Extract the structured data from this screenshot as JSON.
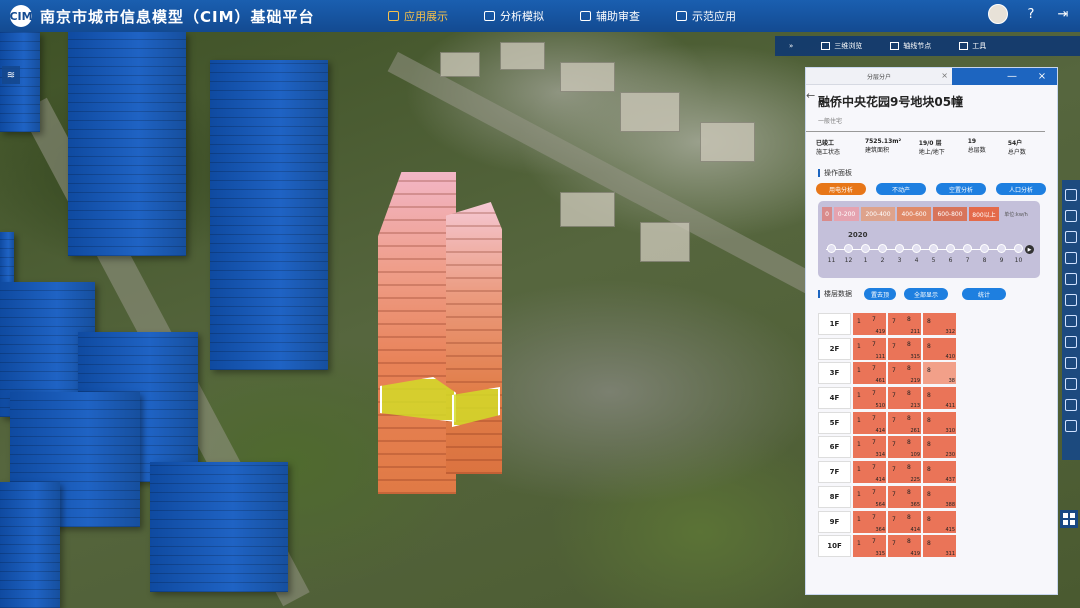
{
  "app": {
    "title": "南京市城市信息模型（CIM）基础平台",
    "logo_text": "CIM"
  },
  "nav": [
    {
      "label": "应用展示",
      "active": true
    },
    {
      "label": "分析模拟",
      "active": false
    },
    {
      "label": "辅助审查",
      "active": false
    },
    {
      "label": "示范应用",
      "active": false
    }
  ],
  "topbar_icons": [
    "user-avatar",
    "help-icon",
    "logout-icon"
  ],
  "subbar": [
    {
      "label": "三维浏览"
    },
    {
      "label": "轴线节点"
    },
    {
      "label": "工具"
    }
  ],
  "panel": {
    "tab_label": "分层分户",
    "building_name": "融侨中央花园9号地块05幢",
    "building_type": "一般住宅",
    "stats": [
      {
        "value": "已竣工",
        "label": "施工状态"
      },
      {
        "value": "7525.13m²",
        "label": "建筑面积"
      },
      {
        "value": "19/0 层",
        "label": "地上/地下"
      },
      {
        "value": "19",
        "label": "总层数"
      },
      {
        "value": "54户",
        "label": "总户数"
      }
    ],
    "ops_title": "操作面板",
    "ops_buttons": [
      "用电分析",
      "不动产",
      "空置分析",
      "人口分析"
    ],
    "legend": [
      "0",
      "0-200",
      "200-400",
      "400-600",
      "600-800",
      "800以上"
    ],
    "legend_unit": "单位:kw/h",
    "year": "2020",
    "months": [
      "11",
      "12",
      "1",
      "2",
      "3",
      "4",
      "5",
      "6",
      "7",
      "8",
      "9",
      "10"
    ],
    "floor_title": "楼层数据",
    "floor_buttons": [
      "置去顶",
      "全部显示",
      "统计"
    ],
    "floors": [
      {
        "label": "1F",
        "units": [
          {
            "n": "1",
            "h": "7",
            "p": "419"
          },
          {
            "n": "7",
            "h": "8",
            "p": "211"
          },
          {
            "n": "8",
            "h": "",
            "p": "312"
          }
        ]
      },
      {
        "label": "2F",
        "units": [
          {
            "n": "1",
            "h": "7",
            "p": "111"
          },
          {
            "n": "7",
            "h": "8",
            "p": "315"
          },
          {
            "n": "8",
            "h": "",
            "p": "410"
          }
        ]
      },
      {
        "label": "3F",
        "units": [
          {
            "n": "1",
            "h": "7",
            "p": "461"
          },
          {
            "n": "7",
            "h": "8",
            "p": "219"
          },
          {
            "n": "8",
            "h": "",
            "p": "38"
          }
        ]
      },
      {
        "label": "4F",
        "units": [
          {
            "n": "1",
            "h": "7",
            "p": "510"
          },
          {
            "n": "7",
            "h": "8",
            "p": "213"
          },
          {
            "n": "8",
            "h": "",
            "p": "411"
          }
        ]
      },
      {
        "label": "5F",
        "units": [
          {
            "n": "1",
            "h": "7",
            "p": "414"
          },
          {
            "n": "7",
            "h": "8",
            "p": "261"
          },
          {
            "n": "8",
            "h": "",
            "p": "310"
          }
        ]
      },
      {
        "label": "6F",
        "units": [
          {
            "n": "1",
            "h": "7",
            "p": "314"
          },
          {
            "n": "7",
            "h": "8",
            "p": "109"
          },
          {
            "n": "8",
            "h": "",
            "p": "230"
          }
        ]
      },
      {
        "label": "7F",
        "units": [
          {
            "n": "1",
            "h": "7",
            "p": "414"
          },
          {
            "n": "7",
            "h": "8",
            "p": "225"
          },
          {
            "n": "8",
            "h": "",
            "p": "437"
          }
        ]
      },
      {
        "label": "8F",
        "units": [
          {
            "n": "1",
            "h": "7",
            "p": "564"
          },
          {
            "n": "7",
            "h": "8",
            "p": "365"
          },
          {
            "n": "8",
            "h": "",
            "p": "388"
          }
        ]
      },
      {
        "label": "9F",
        "units": [
          {
            "n": "1",
            "h": "7",
            "p": "364"
          },
          {
            "n": "7",
            "h": "8",
            "p": "414"
          },
          {
            "n": "8",
            "h": "",
            "p": "415"
          }
        ]
      },
      {
        "label": "10F",
        "units": [
          {
            "n": "1",
            "h": "7",
            "p": "315"
          },
          {
            "n": "7",
            "h": "8",
            "p": "419"
          },
          {
            "n": "8",
            "h": "",
            "p": "311"
          }
        ]
      }
    ]
  },
  "colors": {
    "nav_active": "#f6c04a",
    "topbar": "#134a91",
    "accent_blue": "#1e7fe0",
    "accent_orange": "#e77618",
    "legend_colors": [
      "#d98b8b",
      "#e5a3b0",
      "#dea38c",
      "#e08a68",
      "#d8745a",
      "#e46a4a"
    ]
  }
}
